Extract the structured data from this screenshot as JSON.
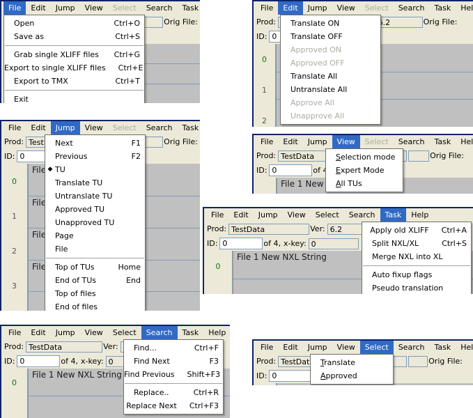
{
  "menubar": {
    "items": [
      "File",
      "Edit",
      "Jump",
      "View",
      "Select",
      "Search",
      "Task",
      "Help"
    ]
  },
  "form": {
    "prod_label": "Prod:",
    "prod_value": "TestData",
    "ver_label": "Ver:",
    "ver_value": "6.2",
    "orig_label": "Orig File:",
    "id_label": "ID:",
    "id_value": "0",
    "of_label": "of 4,",
    "xkey_label": "x-key:",
    "xkey_value": "0"
  },
  "grid": {
    "gutter": [
      "0",
      "1",
      "2",
      "3"
    ],
    "rows": [
      "File 1 New NXL String",
      "File 1 New NXL String",
      "File 1 New NXL String",
      "File 1 New NXL String"
    ],
    "row_short": [
      "File",
      "File",
      "File",
      "File"
    ],
    "row_clip_ing": [
      "ing",
      "g",
      "ng"
    ]
  },
  "panels": {
    "file": {
      "active_menu": "File",
      "items": [
        {
          "label": "Open",
          "accel": "Ctrl+O",
          "disabled": false,
          "bullet": ""
        },
        {
          "label": "Save as",
          "accel": "Ctrl+S",
          "disabled": false,
          "bullet": ""
        },
        {
          "sep": true
        },
        {
          "label": "Grab single XLIFF files",
          "accel": "Ctrl+G",
          "disabled": false,
          "bullet": ""
        },
        {
          "label": "Export to single XLIFF files",
          "accel": "Ctrl+E",
          "disabled": false,
          "bullet": ""
        },
        {
          "label": "Export to TMX",
          "accel": "Ctrl+T",
          "disabled": false,
          "bullet": ""
        },
        {
          "sep": true
        },
        {
          "label": "Exit",
          "accel": "",
          "disabled": false,
          "bullet": ""
        }
      ]
    },
    "edit": {
      "active_menu": "Edit",
      "items": [
        {
          "label": "Translate ON",
          "accel": "",
          "disabled": false,
          "bullet": ""
        },
        {
          "label": "Translate OFF",
          "accel": "",
          "disabled": false,
          "bullet": ""
        },
        {
          "label": "Approved ON",
          "accel": "",
          "disabled": true,
          "bullet": ""
        },
        {
          "label": "Approved OFF",
          "accel": "",
          "disabled": true,
          "bullet": ""
        },
        {
          "label": "Translate All",
          "accel": "",
          "disabled": false,
          "bullet": ""
        },
        {
          "label": "Untranslate All",
          "accel": "",
          "disabled": false,
          "bullet": ""
        },
        {
          "label": "Approve All",
          "accel": "",
          "disabled": true,
          "bullet": ""
        },
        {
          "label": "Unapprove All",
          "accel": "",
          "disabled": true,
          "bullet": ""
        }
      ]
    },
    "jump": {
      "active_menu": "Jump",
      "items": [
        {
          "label": "Next",
          "accel": "F1",
          "disabled": false,
          "bullet": ""
        },
        {
          "label": "Previous",
          "accel": "F2",
          "disabled": false,
          "bullet": ""
        },
        {
          "label": "TU",
          "accel": "",
          "disabled": false,
          "bullet": "◆"
        },
        {
          "label": "Translate TU",
          "accel": "",
          "disabled": false,
          "bullet": ""
        },
        {
          "label": "Untranslate TU",
          "accel": "",
          "disabled": false,
          "bullet": ""
        },
        {
          "label": "Approved TU",
          "accel": "",
          "disabled": false,
          "bullet": ""
        },
        {
          "label": "Unapproved TU",
          "accel": "",
          "disabled": false,
          "bullet": ""
        },
        {
          "label": "Page",
          "accel": "",
          "disabled": false,
          "bullet": ""
        },
        {
          "label": "File",
          "accel": "",
          "disabled": false,
          "bullet": ""
        },
        {
          "sep": true
        },
        {
          "label": "Top of TUs",
          "accel": "Home",
          "disabled": false,
          "bullet": ""
        },
        {
          "label": "End of TUs",
          "accel": "End",
          "disabled": false,
          "bullet": ""
        },
        {
          "label": "Top of files",
          "accel": "",
          "disabled": false,
          "bullet": ""
        },
        {
          "label": "End of files",
          "accel": "",
          "disabled": false,
          "bullet": ""
        }
      ]
    },
    "view": {
      "active_menu": "View",
      "items": [
        {
          "label": "Selection mode",
          "accel": "",
          "disabled": false,
          "bullet": "",
          "mnemonic": "S"
        },
        {
          "label": "Expert Mode",
          "accel": "",
          "disabled": false,
          "bullet": "",
          "mnemonic": "E"
        },
        {
          "label": "All TUs",
          "accel": "",
          "disabled": false,
          "bullet": "",
          "mnemonic": "A"
        }
      ]
    },
    "task": {
      "active_menu": "Task",
      "items": [
        {
          "label": "Apply old XLIFF",
          "accel": "Ctrl+A",
          "disabled": false,
          "bullet": ""
        },
        {
          "label": "Split NXL/XL",
          "accel": "Ctrl+S",
          "disabled": false,
          "bullet": ""
        },
        {
          "label": "Merge NXL into XL",
          "accel": "",
          "disabled": false,
          "bullet": ""
        },
        {
          "sep": true
        },
        {
          "label": "Auto fixup flags",
          "accel": "",
          "disabled": false,
          "bullet": ""
        },
        {
          "label": "Pseudo translation",
          "accel": "",
          "disabled": false,
          "bullet": ""
        }
      ]
    },
    "search": {
      "active_menu": "Search",
      "items": [
        {
          "label": "Find...",
          "accel": "Ctrl+F",
          "disabled": false,
          "bullet": ""
        },
        {
          "label": "Find Next",
          "accel": "F3",
          "disabled": false,
          "bullet": ""
        },
        {
          "label": "Find Previous",
          "accel": "Shift+F3",
          "disabled": false,
          "bullet": ""
        },
        {
          "sep": true
        },
        {
          "label": "Replace..",
          "accel": "Ctrl+R",
          "disabled": false,
          "bullet": ""
        },
        {
          "label": "Replace Next",
          "accel": "Ctrl+F3",
          "disabled": false,
          "bullet": ""
        }
      ]
    },
    "select": {
      "active_menu": "Select",
      "items": [
        {
          "label": "Translate",
          "accel": "",
          "disabled": false,
          "bullet": "",
          "mnemonic": "T"
        },
        {
          "label": "Approved",
          "accel": "",
          "disabled": false,
          "bullet": "",
          "mnemonic": "A"
        }
      ]
    }
  }
}
